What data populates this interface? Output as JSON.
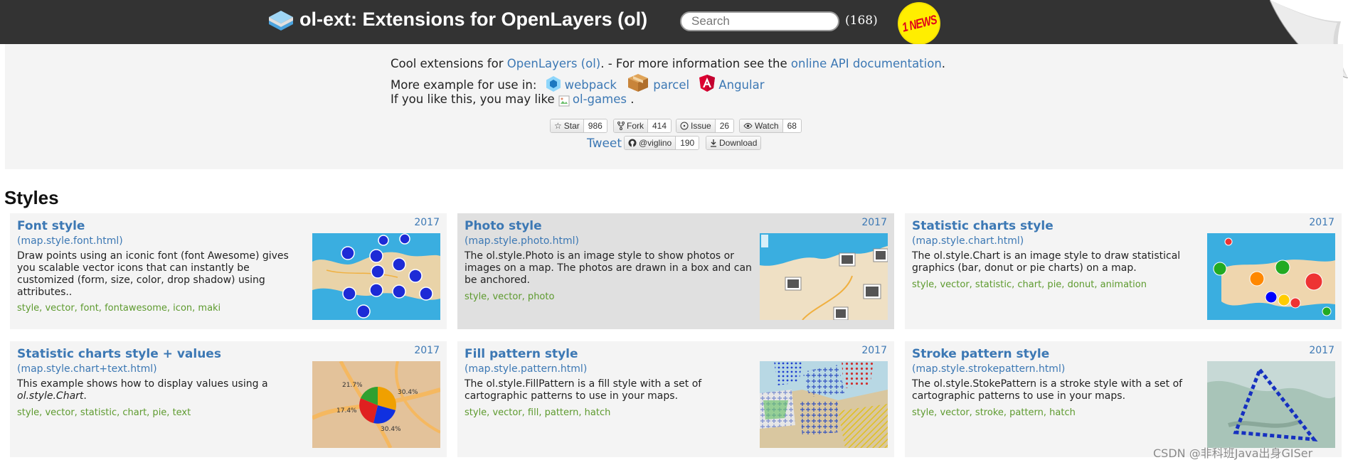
{
  "header": {
    "title": "ol-ext: Extensions for OpenLayers (ol)",
    "search_placeholder": "Search",
    "count": "(168)",
    "news_badge": "1 NEWS"
  },
  "intro": {
    "line1_prefix": "Cool extensions for ",
    "line1_link1": "OpenLayers (ol)",
    "line1_mid": ". - For more information see the ",
    "line1_link2": "online API documentation",
    "line1_suffix": ".",
    "line2_prefix": "More example for use in:",
    "bundlers": [
      {
        "label": "webpack",
        "icon": "webpack-icon"
      },
      {
        "label": "parcel",
        "icon": "parcel-icon"
      },
      {
        "label": "Angular",
        "icon": "angular-icon"
      }
    ],
    "line3_prefix": "If you like this, you may like",
    "line3_link": "ol-games",
    "line3_suffix": "."
  },
  "github": {
    "star": {
      "label": "Star",
      "count": "986"
    },
    "fork": {
      "label": "Fork",
      "count": "414"
    },
    "issue": {
      "label": "Issue",
      "count": "26"
    },
    "watch": {
      "label": "Watch",
      "count": "68"
    },
    "follow": {
      "label": "@viglino",
      "count": "190"
    },
    "download": {
      "label": "Download"
    },
    "tweet": "Tweet"
  },
  "section": {
    "title": "Styles"
  },
  "cards": [
    {
      "title": "Font style",
      "file": "(map.style.font.html)",
      "year": "2017",
      "desc": "Draw points using an iconic font (font Awesome) gives you scalable vector icons that can instantly be customized (form, size, color, drop shadow) using attributes..",
      "tags": "style, vector, font, fontawesome, icon, maki"
    },
    {
      "title": "Photo style",
      "file": "(map.style.photo.html)",
      "year": "2017",
      "desc": "The ol.style.Photo is an image style to show photos or images on a map. The photos are drawn in a box and can be anchored.",
      "tags": "style, vector, photo"
    },
    {
      "title": "Statistic charts style",
      "file": "(map.style.chart.html)",
      "year": "2017",
      "desc": "The ol.style.Chart is an image style to draw statistical graphics (bar, donut or pie charts) on a map.",
      "tags": "style, vector, statistic, chart, pie, donut, animation"
    },
    {
      "title": "Statistic charts style + values",
      "file": "(map.style.chart+text.html)",
      "year": "2017",
      "desc_prefix": "This example shows how to display values using a ",
      "desc_em": "ol.style.Chart",
      "desc_suffix": ".",
      "tags": "style, vector, statistic, chart, pie, text",
      "pie_labels": [
        "21.7%",
        "30.4%",
        "17.4%",
        "30.4%"
      ]
    },
    {
      "title": "Fill pattern style",
      "file": "(map.style.pattern.html)",
      "year": "2017",
      "desc": "The ol.style.FillPattern is a fill style with a set of cartographic patterns to use in your maps.",
      "tags": "style, vector, fill, pattern, hatch"
    },
    {
      "title": "Stroke pattern style",
      "file": "(map.style.strokepattern.html)",
      "year": "2017",
      "desc": "The ol.style.StokePattern is a stroke style with a set of cartographic patterns to use in your maps.",
      "tags": "style, vector, stroke, pattern, hatch"
    }
  ],
  "watermark": "CSDN @非科班Java出身GISer",
  "colors": {
    "header_bg": "#333333",
    "link": "#3c78b4",
    "tag": "#5d9a2e",
    "panel_bg": "#f4f4f4",
    "card_active_bg": "#e0e0e0",
    "news_bg": "#ffee00",
    "news_text": "#e0001b"
  }
}
